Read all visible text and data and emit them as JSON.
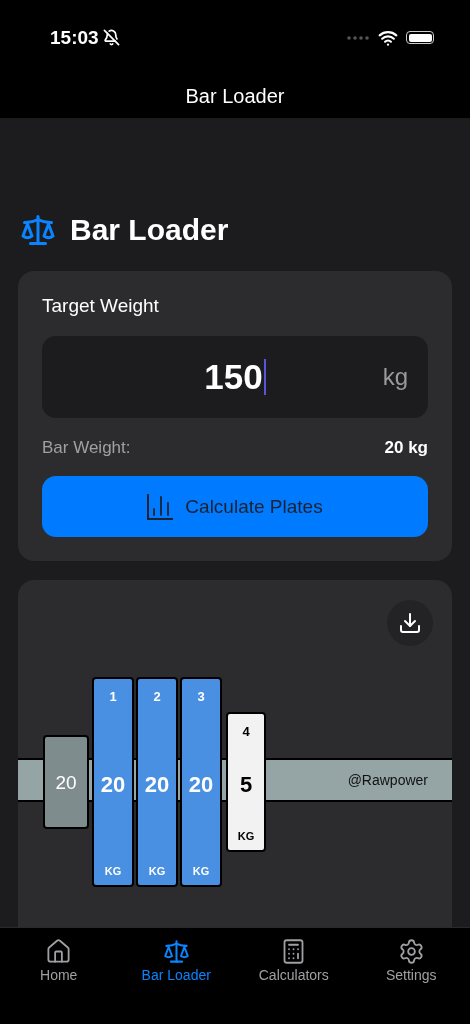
{
  "status_bar": {
    "time": "15:03",
    "silent": true
  },
  "nav": {
    "title": "Bar Loader"
  },
  "heading": {
    "title": "Bar Loader"
  },
  "target": {
    "label": "Target Weight",
    "value": "150",
    "unit": "kg",
    "focused": true
  },
  "bar_weight": {
    "label": "Bar Weight:",
    "value": "20 kg"
  },
  "calculate_button": {
    "label": "Calculate Plates"
  },
  "loader": {
    "watermark": "@Rawpower",
    "plates": [
      {
        "kind": "collar",
        "weight": "20",
        "color": "#7f8c8d"
      },
      {
        "kind": "plate",
        "number": "1",
        "weight": "20",
        "unit": "KG",
        "color": "#4a90e2"
      },
      {
        "kind": "plate",
        "number": "2",
        "weight": "20",
        "unit": "KG",
        "color": "#4a90e2"
      },
      {
        "kind": "plate",
        "number": "3",
        "weight": "20",
        "unit": "KG",
        "color": "#4a90e2"
      },
      {
        "kind": "small_plate",
        "number": "4",
        "weight": "5",
        "unit": "KG",
        "color": "#f2f2f2"
      }
    ]
  },
  "tabs": [
    {
      "label": "Home",
      "kind": "home",
      "selected": false
    },
    {
      "label": "Bar Loader",
      "kind": "scale",
      "selected": true
    },
    {
      "label": "Calculators",
      "kind": "calculator",
      "selected": false
    },
    {
      "label": "Settings",
      "kind": "settings",
      "selected": false
    }
  ]
}
